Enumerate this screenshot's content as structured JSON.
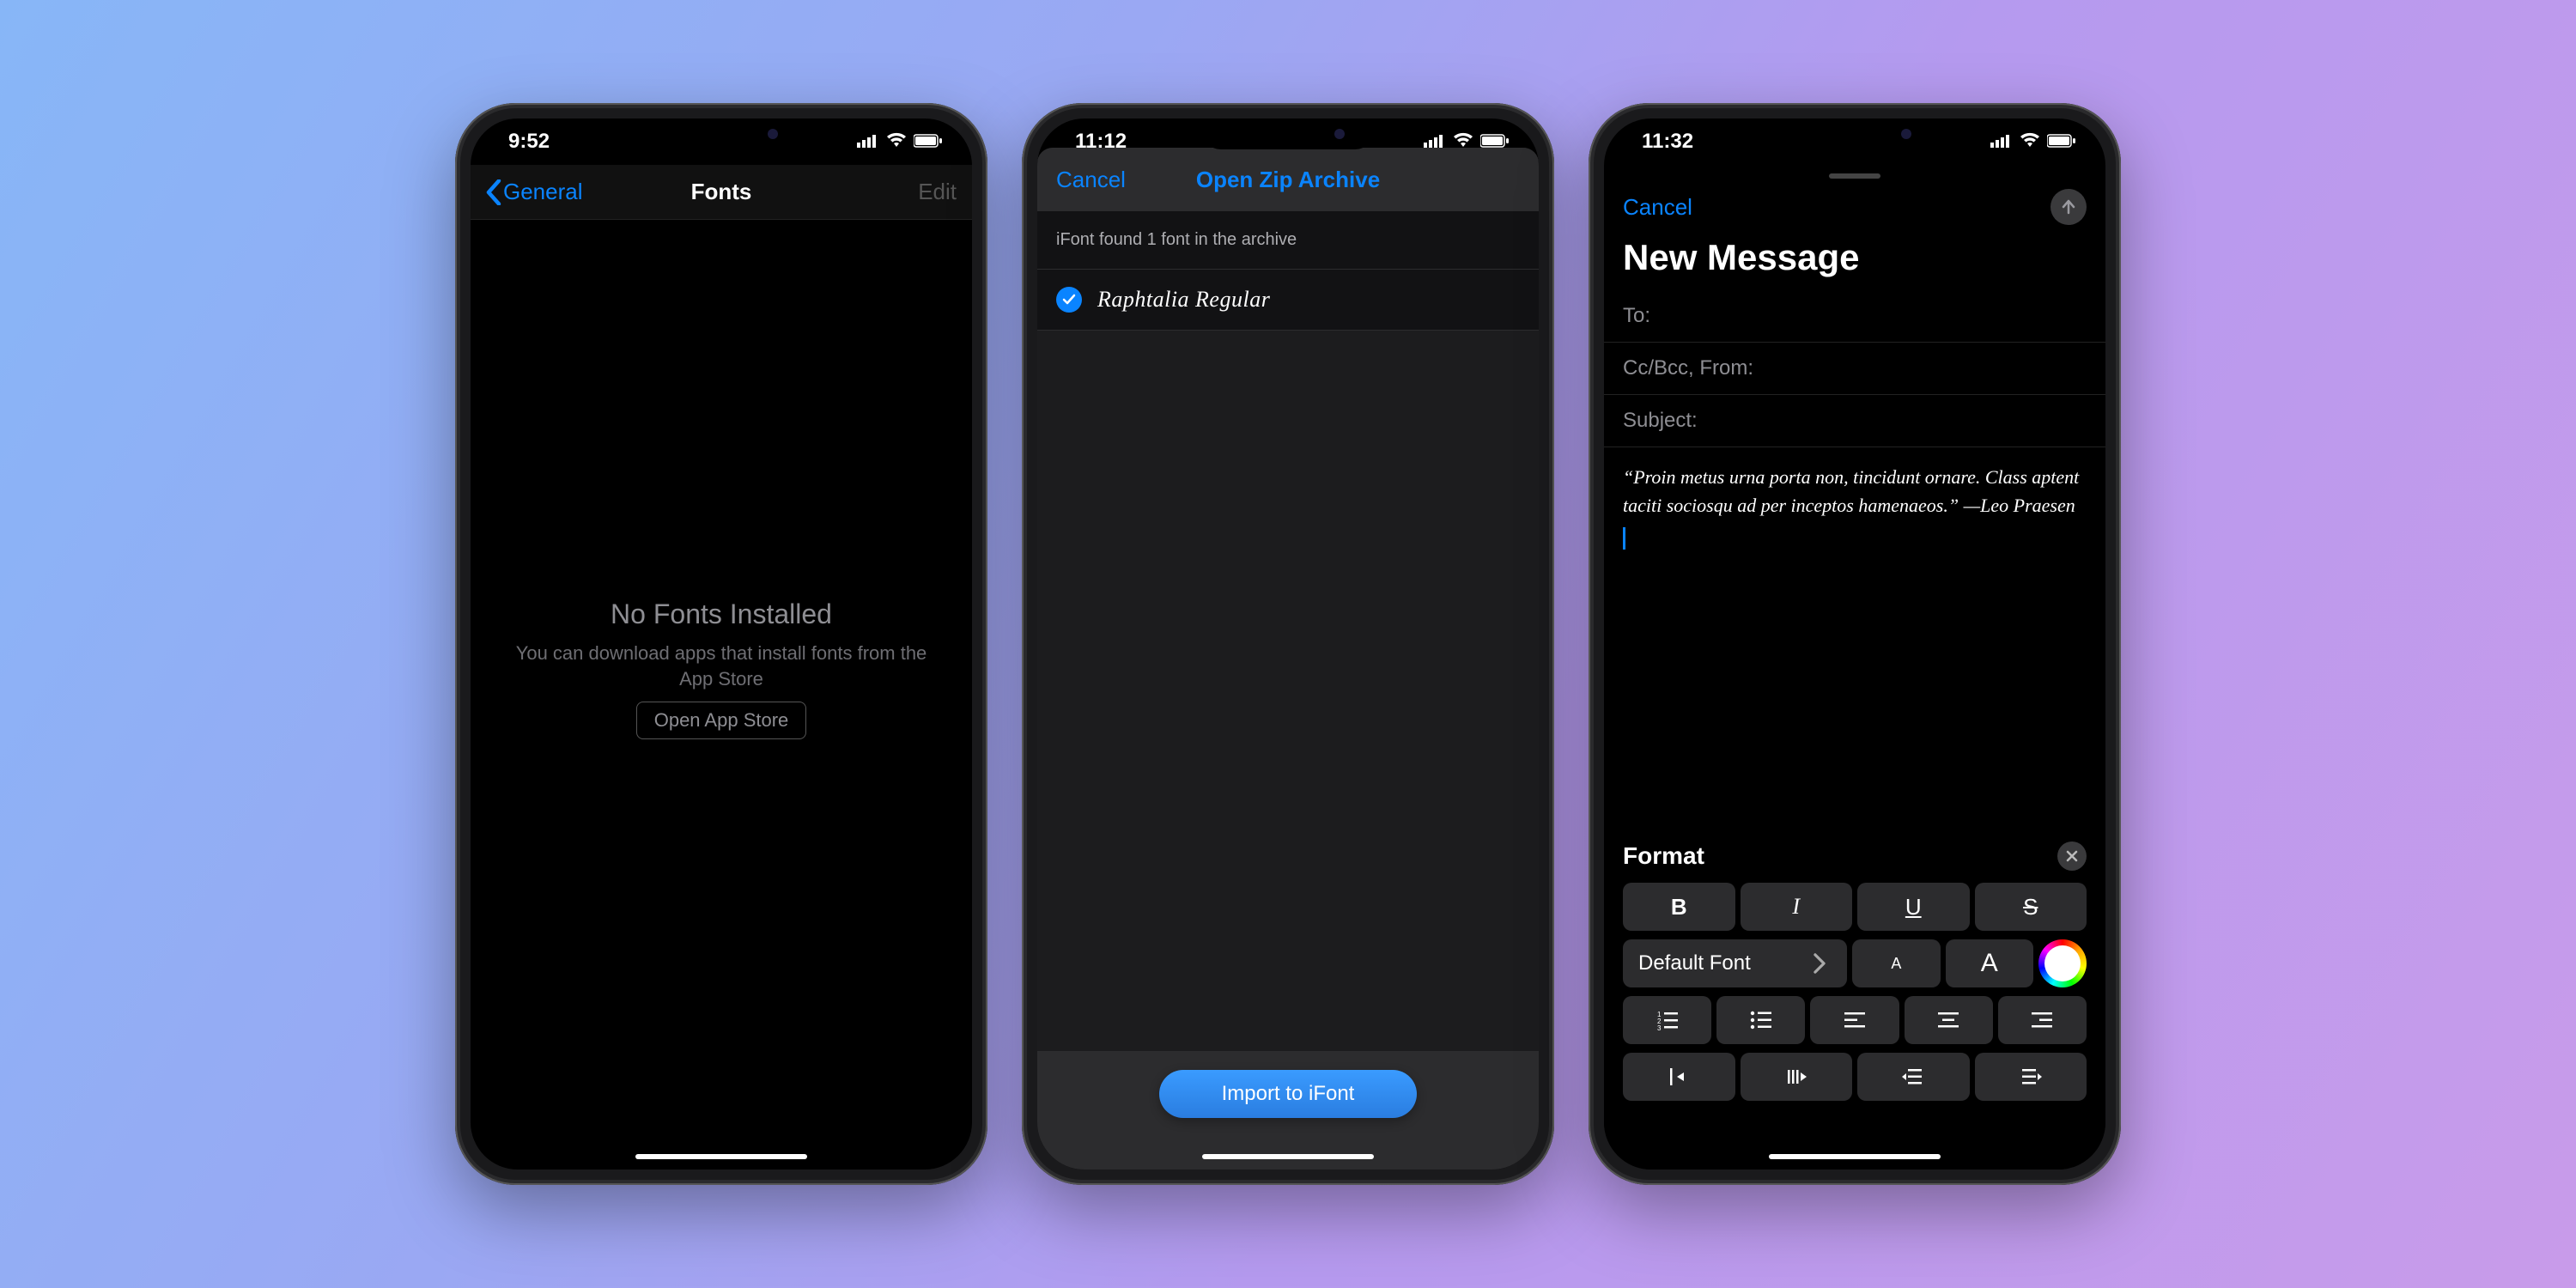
{
  "phone1": {
    "status_time": "9:52",
    "nav": {
      "back_label": "General",
      "title": "Fonts",
      "edit_label": "Edit"
    },
    "empty": {
      "title": "No Fonts Installed",
      "subtitle": "You can download apps that install fonts from the App Store",
      "button": "Open App Store"
    }
  },
  "phone2": {
    "status_time": "11:12",
    "sheet": {
      "cancel": "Cancel",
      "title": "Open Zip Archive",
      "info": "iFont found 1 font in the archive",
      "font_item": "Raphtalia Regular",
      "import_button": "Import to iFont"
    }
  },
  "phone3": {
    "status_time": "11:32",
    "compose": {
      "cancel": "Cancel",
      "title": "New Message",
      "to_label": "To:",
      "cc_label": "Cc/Bcc, From:",
      "subject_label": "Subject:",
      "body": "“Proin metus urna porta non, tincidunt ornare. Class aptent taciti sociosqu ad per inceptos hamenaeos.” —Leo Praesen"
    },
    "format": {
      "title": "Format",
      "bold": "B",
      "italic": "I",
      "underline": "U",
      "strike": "S",
      "font_picker": "Default Font",
      "size_small": "A",
      "size_large": "A"
    }
  }
}
